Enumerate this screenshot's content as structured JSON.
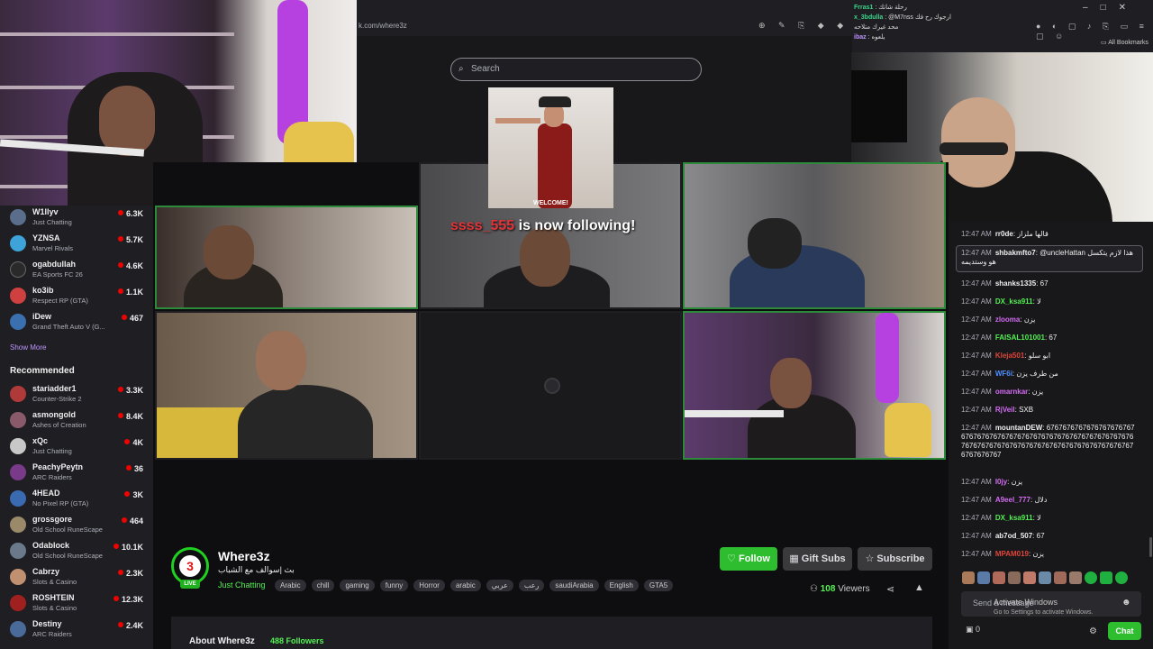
{
  "browser": {
    "url": "k.com/where3z",
    "top_chat": [
      {
        "user": "Frras1",
        "text": ": رحلة شاتك"
      },
      {
        "user": "x_3bdulla",
        "text": ": @M7nss ارجوك رح فك"
      },
      {
        "user": "",
        "text": "محد غيرك متلاحه"
      },
      {
        "user": "ibaz",
        "text": ": يلعوه"
      }
    ],
    "bookmarks_label": "All Bookmarks",
    "window_controls": [
      "–",
      "□",
      "✕"
    ]
  },
  "search": {
    "placeholder": "Search"
  },
  "follow_alert": {
    "welcome": "WELCOME!",
    "user": "ssss_555",
    "text": " is now following!"
  },
  "sidebar": {
    "followed": [
      {
        "name": "W1llyv",
        "game": "Just Chatting",
        "viewers": "6.3K",
        "color": "#5a6d8a"
      },
      {
        "name": "YZNSA",
        "game": "Marvel Rivals",
        "viewers": "5.7K",
        "color": "#3ea3d8"
      },
      {
        "name": "ogabdullah",
        "game": "EA Sports FC 26",
        "viewers": "4.6K",
        "color": "#2a2a2a"
      },
      {
        "name": "ko3ib",
        "game": "Respect RP (GTA)",
        "viewers": "1.1K",
        "color": "#d04040"
      },
      {
        "name": "iDew",
        "game": "Grand Theft Auto V (G...",
        "viewers": "467",
        "color": "#3a70b0"
      }
    ],
    "show_more": "Show More",
    "recommended_heading": "Recommended",
    "recommended": [
      {
        "name": "stariadder1",
        "game": "Counter-Strike 2",
        "viewers": "3.3K",
        "color": "#b03a3a"
      },
      {
        "name": "asmongold",
        "game": "Ashes of Creation",
        "viewers": "8.4K",
        "color": "#8a5a6a"
      },
      {
        "name": "xQc",
        "game": "Just Chatting",
        "viewers": "4K",
        "color": "#c8c8c8"
      },
      {
        "name": "PeachyPeytn",
        "game": "ARC Raiders",
        "viewers": "36",
        "color": "#7a3a8a"
      },
      {
        "name": "4HEAD",
        "game": "No Pixel RP (GTA)",
        "viewers": "3K",
        "color": "#3a6ab0"
      },
      {
        "name": "grossgore",
        "game": "Old School RuneScape",
        "viewers": "464",
        "color": "#9a8a6a"
      },
      {
        "name": "Odablock",
        "game": "Old School RuneScape",
        "viewers": "10.1K",
        "color": "#6a7a8a"
      },
      {
        "name": "Cabrzy",
        "game": "Slots & Casino",
        "viewers": "2.3K",
        "color": "#c09070"
      },
      {
        "name": "ROSHTEIN",
        "game": "Slots & Casino",
        "viewers": "12.3K",
        "color": "#a02020"
      },
      {
        "name": "Destiny",
        "game": "ARC Raiders",
        "viewers": "2.4K",
        "color": "#4a6a9a"
      }
    ]
  },
  "channel": {
    "name": "Where3z",
    "title": "بث |سوالف مع الشباب",
    "category": "Just Chatting",
    "tags": [
      "Arabic",
      "chill",
      "gaming",
      "funny",
      "Horror",
      "arabic",
      "عربي",
      "رعب",
      "saudiArabia",
      "English",
      "GTA5"
    ],
    "follow_label": "Follow",
    "gift_label": "Gift Subs",
    "subscribe_label": "Subscribe",
    "viewer_count": "108",
    "viewers_label": " Viewers",
    "about_label": "About Where3z",
    "followers": "488 Followers",
    "live_label": "LIVE",
    "logo_letter": "3"
  },
  "chat": {
    "messages": [
      {
        "time": "12:47 AM",
        "user": "rr0de",
        "sep": ":",
        "text": "قالها ملزاز",
        "color": "#efeff1"
      },
      {
        "time": "12:47 AM",
        "user": "shbakmfto7",
        "sep": ":",
        "text": "@uncleHattan هذا لازم يتكسل هو وستديمه",
        "color": "#efeff1"
      },
      {
        "time": "12:47 AM",
        "user": "shanks1335",
        "sep": ":",
        "text": "67",
        "color": "#efeff1"
      },
      {
        "time": "12:47 AM",
        "user": "DX_ksa911",
        "sep": ":",
        "text": "لا",
        "color": "#53f153"
      },
      {
        "time": "12:47 AM",
        "user": "zlooma",
        "sep": ":",
        "text": "يزن",
        "color": "#d36cf2"
      },
      {
        "time": "12:47 AM",
        "user": "FAISAL101001",
        "sep": ":",
        "text": "67",
        "color": "#53f153"
      },
      {
        "time": "12:47 AM",
        "user": "Kleja501",
        "sep": ":",
        "text": "ابو سلو",
        "color": "#e0453a"
      },
      {
        "time": "12:47 AM",
        "user": "WF6i",
        "sep": ":",
        "text": "من طرف يزن",
        "color": "#4d8fff"
      },
      {
        "time": "12:47 AM",
        "user": "omarnkar",
        "sep": ":",
        "text": "يزن",
        "color": "#d36cf2"
      },
      {
        "time": "12:47 AM",
        "user": "RjVeil",
        "sep": ":",
        "text": "SXB",
        "color": "#d36cf2"
      },
      {
        "time": "12:47 AM",
        "user": "mountanDEW",
        "sep": ":",
        "text": "6767676767676767676767676767676767676767676767676767676767676767676767676767676767676767676767676767676767676767676767",
        "color": "#efeff1"
      },
      {
        "time": "12:47 AM",
        "user": "I0jy",
        "sep": ":",
        "text": "يزن",
        "color": "#d36cf2"
      },
      {
        "time": "12:47 AM",
        "user": "A9eel_777",
        "sep": ":",
        "text": "دلال",
        "color": "#d36cf2"
      },
      {
        "time": "12:47 AM",
        "user": "DX_ksa911",
        "sep": ":",
        "text": "لا",
        "color": "#53f153"
      },
      {
        "time": "12:47 AM",
        "user": "ab7od_507",
        "sep": ":",
        "text": "67",
        "color": "#efeff1"
      },
      {
        "time": "12:47 AM",
        "user": "MPAM019",
        "sep": ":",
        "text": "يزن",
        "color": "#e0453a"
      }
    ],
    "input_placeholder": "Send a message",
    "activate_windows": "Activate Windows",
    "activate_sub": "Go to Settings to activate Windows.",
    "points": "0",
    "chat_button": "Chat"
  }
}
